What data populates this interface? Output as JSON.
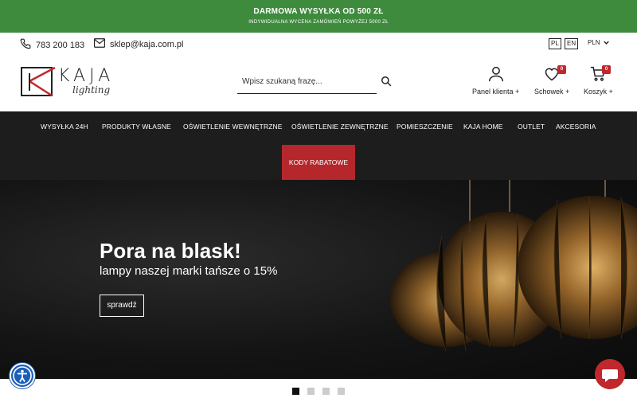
{
  "topbar": {
    "headline": "DARMOWA WYSYŁKA OD 500 ZŁ",
    "subline": "INDYWIDUALNA WYCENA ZAMÓWIEŃ POWYŻEJ 5000 ZŁ"
  },
  "contact": {
    "phone": "783 200 183",
    "email": "sklep@kaja.com.pl"
  },
  "languages": [
    "PL",
    "EN"
  ],
  "currency": "PLN",
  "logo": {
    "brand": "KAJA",
    "tagline": "lighting"
  },
  "search": {
    "placeholder": "Wpisz szukaną frazę..."
  },
  "header_icons": {
    "account": "Panel klienta",
    "wishlist": "Schowek",
    "wishlist_count": "0",
    "cart": "Koszyk",
    "cart_count": "0"
  },
  "nav": {
    "items": [
      "WYSYŁKA 24H",
      "PRODUKTY WŁASNE",
      "OŚWIETLENIE WEWNĘTRZNE",
      "OŚWIETLENIE ZEWNĘTRZNE",
      "POMIESZCZENIE",
      "KAJA HOME",
      "OUTLET",
      "AKCESORIA"
    ],
    "promo": "KODY RABATOWE"
  },
  "hero": {
    "title": "Pora na blask!",
    "subtitle": "lampy naszej marki tańsze o 15%",
    "cta": "sprawdź"
  },
  "colors": {
    "topbar": "#3e8b3e",
    "nav_bg": "#1d1d1d",
    "accent": "#b5272b",
    "badge": "#c0282d"
  },
  "icons": [
    "phone-icon",
    "mail-icon",
    "search-icon",
    "user-icon",
    "heart-icon",
    "cart-icon",
    "accessibility-icon",
    "chat-icon"
  ]
}
